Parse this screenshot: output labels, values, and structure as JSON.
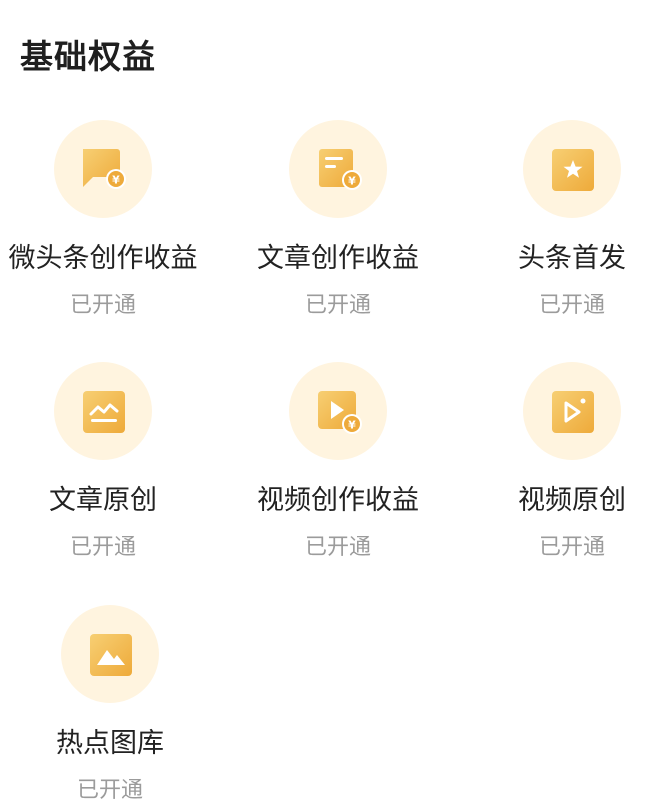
{
  "section": {
    "title": "基础权益"
  },
  "benefits": [
    {
      "label": "微头条创作收益",
      "status": "已开通",
      "icon": "comment-yuan-icon"
    },
    {
      "label": "文章创作收益",
      "status": "已开通",
      "icon": "article-yuan-icon"
    },
    {
      "label": "头条首发",
      "status": "已开通",
      "icon": "star-icon"
    },
    {
      "label": "文章原创",
      "status": "已开通",
      "icon": "chart-icon"
    },
    {
      "label": "视频创作收益",
      "status": "已开通",
      "icon": "video-yuan-icon"
    },
    {
      "label": "视频原创",
      "status": "已开通",
      "icon": "video-original-icon"
    },
    {
      "label": "热点图库",
      "status": "已开通",
      "icon": "image-icon"
    }
  ],
  "colors": {
    "icon_circle": "#fff4df",
    "icon_gold": "#f0b84a",
    "status_text": "#9b9b9b"
  }
}
